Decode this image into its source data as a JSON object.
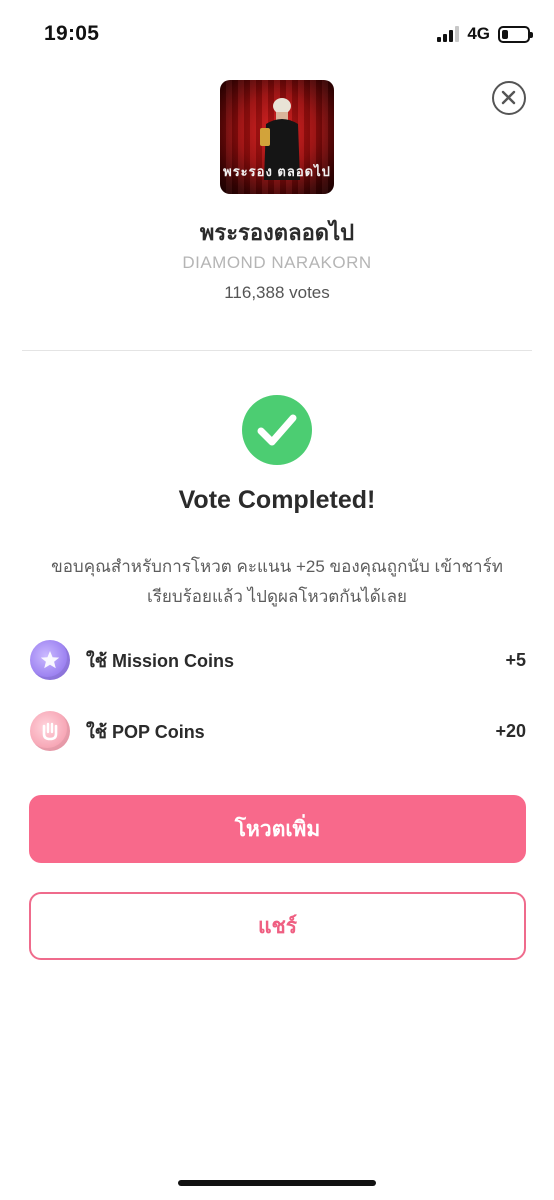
{
  "status_bar": {
    "time": "19:05",
    "network": "4G",
    "battery_level": 0.25
  },
  "song": {
    "title": "พระรองตลอดไป",
    "artist": "DIAMOND NARAKORN",
    "votes": "116,388 votes",
    "cover_text": "พระรอง ตลอดไป"
  },
  "result": {
    "heading": "Vote Completed!",
    "message": "ขอบคุณสำหรับการโหวต คะแนน +25 ของคุณถูกนับ เข้าชาร์ท เรียบร้อยแล้ว ไปดูผลโหวตกันได้เลย"
  },
  "coins": [
    {
      "label": "ใช้ Mission Coins",
      "value": "+5",
      "icon": "star-coin-icon"
    },
    {
      "label": "ใช้ POP Coins",
      "value": "+20",
      "icon": "pop-coin-icon"
    }
  ],
  "buttons": {
    "vote_more": "โหวตเพิ่ม",
    "share": "แชร์"
  },
  "colors": {
    "primary": "#f8698b",
    "success": "#4ccd72",
    "mission_coin": "#9d83f1",
    "pop_coin": "#f7a8b7"
  }
}
